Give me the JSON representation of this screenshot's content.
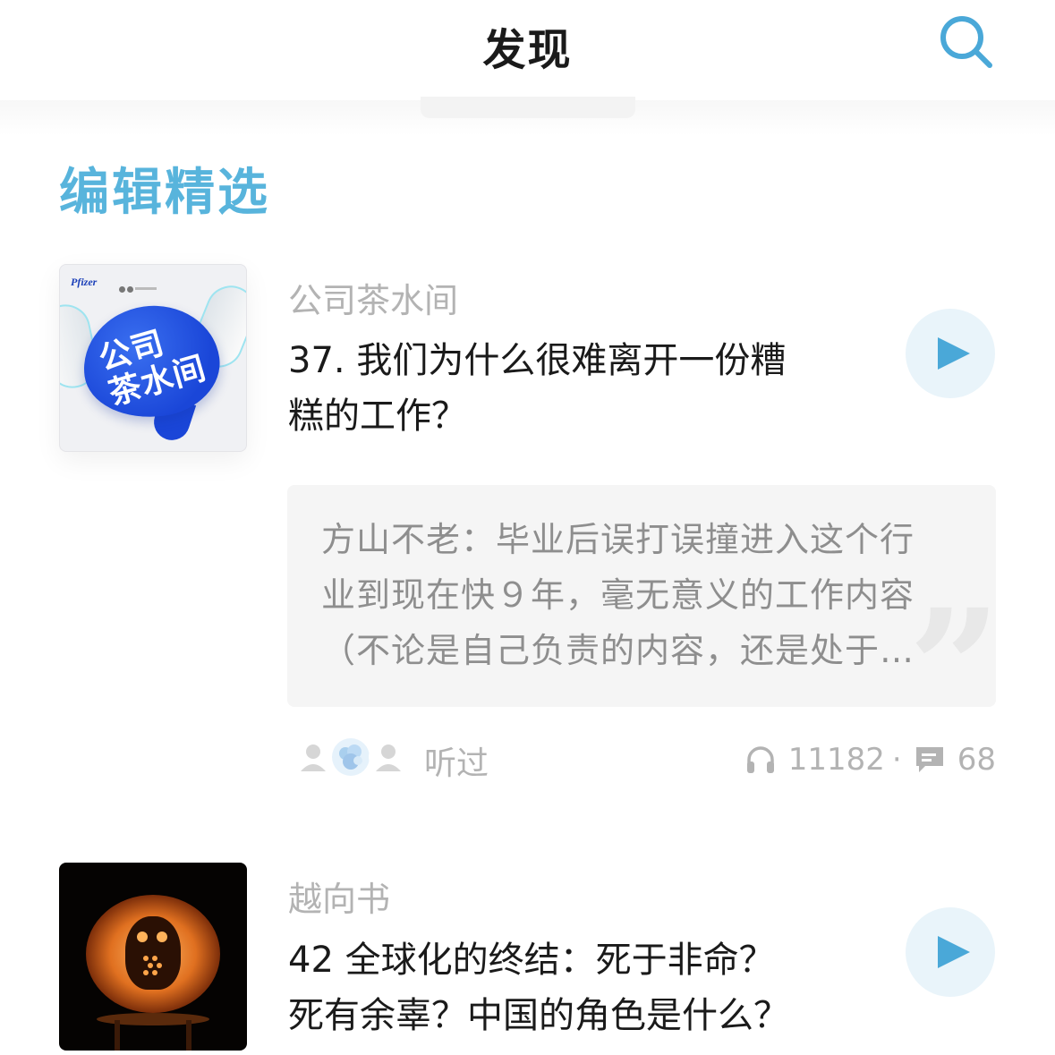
{
  "header": {
    "title": "发现",
    "search_icon": "search-icon"
  },
  "section": {
    "title": "编辑精选"
  },
  "colors": {
    "accent": "#58b4dc",
    "play_bg": "#e9f4fa",
    "play_icon": "#4aa8d8",
    "secondary_text": "#b3b3b3"
  },
  "episodes": [
    {
      "podcast": "公司茶水间",
      "title": "37. 我们为什么很难离开一份糟糕的工作？",
      "title_line1": "37. 我们为什么很难离开一份糟",
      "title_line2": "糕的工作？",
      "cover": {
        "brand": "Pfizer",
        "text_line1": "公司",
        "text_line2": "茶水间"
      },
      "comment": {
        "line1": "方山不老：毕业后误打误撞进入这个行",
        "line2": "业到现在快９年，毫无意义的工作内容",
        "line3": "（不论是自己负责的内容，还是处于…"
      },
      "heard_label": "听过",
      "plays": "11182",
      "dot": "·",
      "comments": "68"
    },
    {
      "podcast": "越向书",
      "title": "42 全球化的终结：死于非命？死有余辜？中国的角色是什么？",
      "title_line1": "42 全球化的终结：死于非命？",
      "title_line2": "死有余辜？中国的角色是什么？"
    }
  ]
}
